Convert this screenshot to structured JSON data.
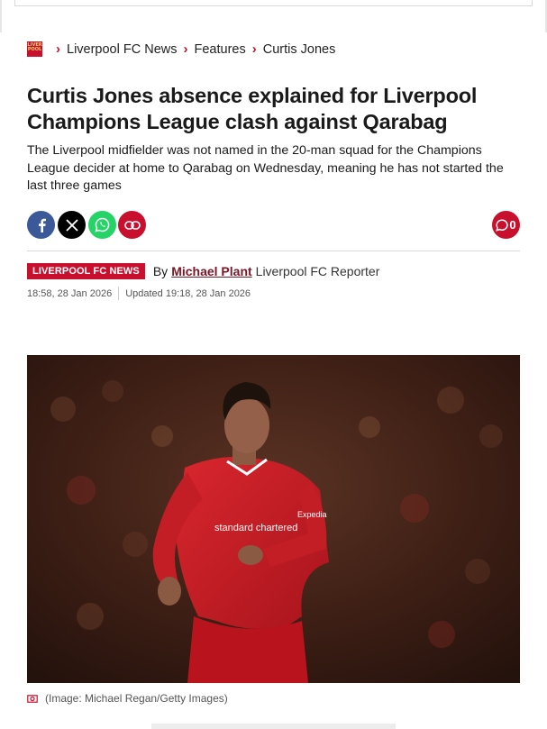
{
  "breadcrumb": {
    "logo_text": "LIVERPOOL",
    "items": [
      "Liverpool FC News",
      "Features",
      "Curtis Jones"
    ],
    "separator": ">"
  },
  "article": {
    "headline": "Curtis Jones absence explained for Liverpool Champions League clash against Qarabag",
    "standfirst": "The Liverpool midfielder was not named in the 20-man squad for the Champions League decider at home to Qarabag on Wednesday, meaning he has not started the last three games",
    "category": "LIVERPOOL FC NEWS",
    "by_label": "By",
    "author": "Michael Plant",
    "author_role": "Liverpool FC Reporter",
    "published": "18:58, 28 Jan 2026",
    "updated": "Updated 19:18, 28 Jan 2026"
  },
  "share": {
    "buttons": [
      "facebook-icon",
      "x-icon",
      "whatsapp-icon",
      "link-icon"
    ],
    "comments_count": "0",
    "colors": {
      "facebook": "#3b5998",
      "x": "#000000",
      "whatsapp": "#25d366",
      "link": "#c8102e"
    }
  },
  "image": {
    "caption": "(Image: Michael Regan/Getty Images)",
    "shirt_sponsor": "standard chartered",
    "sleeve_sponsor": "Expedia"
  },
  "colors": {
    "accent": "#c8102e",
    "author": "#7a1626"
  }
}
